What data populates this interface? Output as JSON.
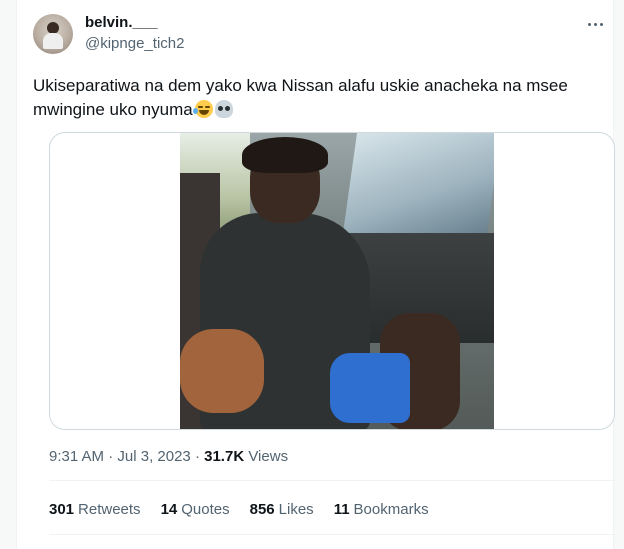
{
  "author": {
    "display_name": "belvin.___",
    "handle": "@kipnge_tich2"
  },
  "tweet": {
    "text": "Ukiseparatiwa na dem yako kwa Nissan alafu uskie anacheka na msee mwingine uko nyuma",
    "emojis": [
      "face-with-tears-of-joy-icon",
      "skull-icon"
    ]
  },
  "meta": {
    "time": "9:31 AM",
    "sep1": " · ",
    "date": "Jul 3, 2023",
    "sep2": " · ",
    "views_count": "31.7K",
    "views_label": " Views"
  },
  "stats": {
    "retweets_count": "301",
    "retweets_label": "Retweets",
    "quotes_count": "14",
    "quotes_label": "Quotes",
    "likes_count": "856",
    "likes_label": "Likes",
    "bookmarks_count": "11",
    "bookmarks_label": "Bookmarks"
  },
  "colors": {
    "text_primary": "#0f1419",
    "text_secondary": "#536471",
    "border": "#cfd9de"
  }
}
